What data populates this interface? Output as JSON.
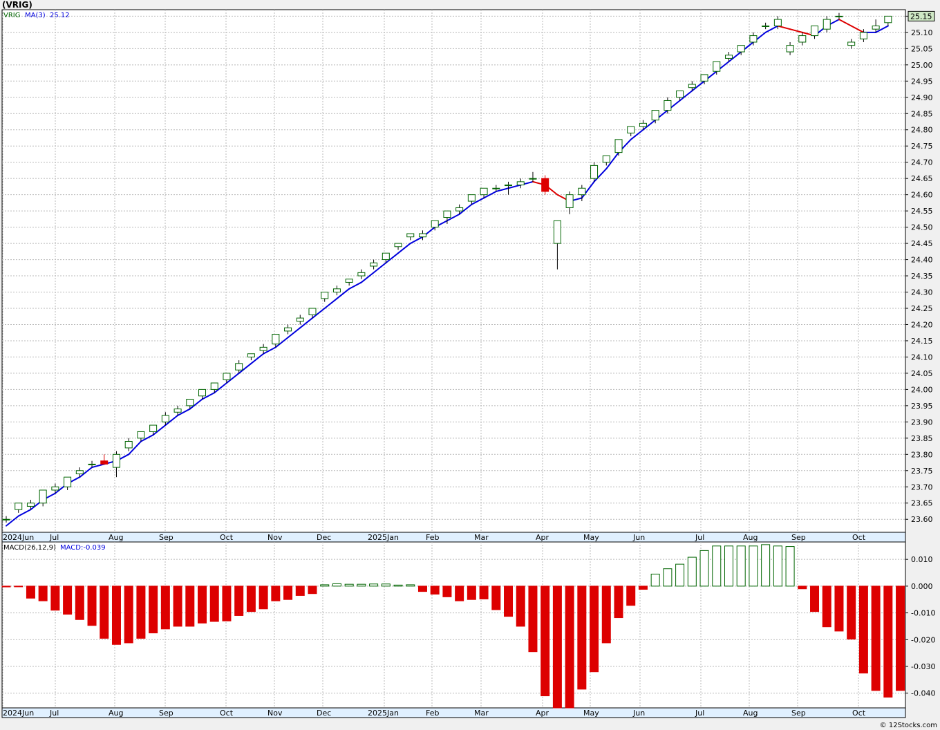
{
  "title": "(VRIG)",
  "credit": "© 12Stocks.com",
  "colors": {
    "up": "#006400",
    "down": "#dd0000",
    "ma_up": "#0000dd",
    "ma_down": "#dd0000",
    "grid": "#b8b8b8",
    "label_bg": "#cfe8c5"
  },
  "chart_data": [
    {
      "type": "candlestick",
      "legend": "VRIG",
      "ma_label": "MA(3)",
      "ma_value": "25.12",
      "last_price_label": "25.15",
      "ylim": [
        23.56,
        25.17
      ],
      "yticks": [
        23.6,
        23.65,
        23.7,
        23.75,
        23.8,
        23.85,
        23.9,
        23.95,
        24.0,
        24.05,
        24.1,
        24.15,
        24.2,
        24.25,
        24.3,
        24.35,
        24.4,
        24.45,
        24.5,
        24.55,
        24.6,
        24.65,
        24.7,
        24.75,
        24.8,
        24.85,
        24.9,
        24.95,
        25.0,
        25.05,
        25.1,
        25.15
      ],
      "xlabels": [
        "2024Jun",
        "Jul",
        "Aug",
        "Sep",
        "Oct",
        "Nov",
        "Dec",
        "2025Jan",
        "Feb",
        "Mar",
        "Apr",
        "May",
        "Jun",
        "Jul",
        "Aug",
        "Sep",
        "Oct"
      ],
      "candles": [
        [
          23.6,
          23.61,
          23.59,
          23.6
        ],
        [
          23.63,
          23.65,
          23.62,
          23.65
        ],
        [
          23.64,
          23.66,
          23.63,
          23.65
        ],
        [
          23.65,
          23.69,
          23.64,
          23.69
        ],
        [
          23.69,
          23.71,
          23.68,
          23.7
        ],
        [
          23.7,
          23.73,
          23.69,
          23.73
        ],
        [
          23.74,
          23.76,
          23.73,
          23.75
        ],
        [
          23.77,
          23.78,
          23.76,
          23.77
        ],
        [
          23.78,
          23.8,
          23.77,
          23.77
        ],
        [
          23.76,
          23.81,
          23.73,
          23.8
        ],
        [
          23.82,
          23.85,
          23.81,
          23.84
        ],
        [
          23.85,
          23.87,
          23.84,
          23.87
        ],
        [
          23.87,
          23.89,
          23.86,
          23.89
        ],
        [
          23.9,
          23.93,
          23.89,
          23.92
        ],
        [
          23.93,
          23.95,
          23.92,
          23.94
        ],
        [
          23.95,
          23.97,
          23.94,
          23.97
        ],
        [
          23.98,
          24.0,
          23.97,
          24.0
        ],
        [
          24.0,
          24.02,
          23.99,
          24.02
        ],
        [
          24.03,
          24.05,
          24.02,
          24.05
        ],
        [
          24.06,
          24.09,
          24.05,
          24.08
        ],
        [
          24.1,
          24.11,
          24.09,
          24.11
        ],
        [
          24.12,
          24.14,
          24.11,
          24.13
        ],
        [
          24.14,
          24.17,
          24.13,
          24.17
        ],
        [
          24.18,
          24.2,
          24.17,
          24.19
        ],
        [
          24.21,
          24.23,
          24.2,
          24.22
        ],
        [
          24.23,
          24.25,
          24.22,
          24.25
        ],
        [
          24.28,
          24.3,
          24.27,
          24.3
        ],
        [
          24.3,
          24.32,
          24.29,
          24.31
        ],
        [
          24.33,
          24.34,
          24.32,
          24.34
        ],
        [
          24.35,
          24.37,
          24.34,
          24.36
        ],
        [
          24.38,
          24.4,
          24.37,
          24.39
        ],
        [
          24.4,
          24.42,
          24.39,
          24.42
        ],
        [
          24.44,
          24.45,
          24.43,
          24.45
        ],
        [
          24.47,
          24.48,
          24.46,
          24.48
        ],
        [
          24.47,
          24.49,
          24.46,
          24.48
        ],
        [
          24.5,
          24.52,
          24.49,
          24.52
        ],
        [
          24.53,
          24.55,
          24.51,
          24.55
        ],
        [
          24.55,
          24.57,
          24.54,
          24.56
        ],
        [
          24.58,
          24.6,
          24.57,
          24.6
        ],
        [
          24.6,
          24.62,
          24.59,
          24.62
        ],
        [
          24.62,
          24.63,
          24.61,
          24.62
        ],
        [
          24.63,
          24.64,
          24.6,
          24.63
        ],
        [
          24.63,
          24.65,
          24.62,
          24.64
        ],
        [
          24.65,
          24.67,
          24.64,
          24.65
        ],
        [
          24.65,
          24.66,
          24.6,
          24.61
        ],
        [
          24.45,
          24.52,
          24.37,
          24.52
        ],
        [
          24.56,
          24.61,
          24.54,
          24.6
        ],
        [
          24.6,
          24.63,
          24.58,
          24.62
        ],
        [
          24.65,
          24.7,
          24.64,
          24.69
        ],
        [
          24.7,
          24.72,
          24.69,
          24.72
        ],
        [
          24.73,
          24.77,
          24.72,
          24.77
        ],
        [
          24.79,
          24.81,
          24.78,
          24.81
        ],
        [
          24.81,
          24.83,
          24.8,
          24.82
        ],
        [
          24.83,
          24.86,
          24.82,
          24.86
        ],
        [
          24.86,
          24.9,
          24.85,
          24.89
        ],
        [
          24.9,
          24.92,
          24.89,
          24.92
        ],
        [
          24.93,
          24.95,
          24.92,
          24.94
        ],
        [
          24.95,
          24.97,
          24.94,
          24.97
        ],
        [
          24.98,
          25.0,
          24.97,
          25.01
        ],
        [
          25.02,
          25.04,
          25.01,
          25.03
        ],
        [
          25.04,
          25.06,
          25.03,
          25.06
        ],
        [
          25.07,
          25.1,
          25.06,
          25.09
        ],
        [
          25.12,
          25.13,
          25.11,
          25.12
        ],
        [
          25.12,
          25.15,
          25.11,
          25.14
        ],
        [
          25.04,
          25.07,
          25.03,
          25.06
        ],
        [
          25.07,
          25.1,
          25.06,
          25.09
        ],
        [
          25.09,
          25.12,
          25.08,
          25.12
        ],
        [
          25.11,
          25.15,
          25.1,
          25.14
        ],
        [
          25.15,
          25.16,
          25.14,
          25.15
        ],
        [
          25.06,
          25.08,
          25.05,
          25.07
        ],
        [
          25.08,
          25.11,
          25.07,
          25.1
        ],
        [
          25.11,
          25.14,
          25.1,
          25.12
        ],
        [
          25.13,
          25.15,
          25.12,
          25.15
        ]
      ],
      "ma": [
        23.58,
        23.61,
        23.63,
        23.66,
        23.68,
        23.71,
        23.73,
        23.76,
        23.77,
        23.78,
        23.8,
        23.84,
        23.86,
        23.89,
        23.92,
        23.94,
        23.97,
        23.99,
        24.02,
        24.05,
        24.08,
        24.11,
        24.13,
        24.16,
        24.19,
        24.22,
        24.25,
        24.28,
        24.31,
        24.33,
        24.36,
        24.39,
        24.42,
        24.45,
        24.47,
        24.5,
        24.52,
        24.54,
        24.57,
        24.59,
        24.61,
        24.62,
        24.63,
        24.64,
        24.63,
        24.6,
        24.58,
        24.59,
        24.64,
        24.68,
        24.73,
        24.77,
        24.8,
        24.83,
        24.86,
        24.89,
        24.92,
        24.95,
        24.98,
        25.01,
        25.04,
        25.07,
        25.1,
        25.12,
        25.11,
        25.1,
        25.09,
        25.12,
        25.14,
        25.12,
        25.1,
        25.1,
        25.12
      ]
    },
    {
      "type": "bar",
      "label": "MACD(26,12,9)",
      "value_label": "MACD:-0.039",
      "ylim": [
        -0.0455,
        0.0165
      ],
      "yticks": [
        0.01,
        0.0,
        -0.01,
        -0.02,
        -0.03,
        -0.04
      ],
      "ytick_labels": [
        "0.010",
        "0.000",
        "-0.010",
        "-0.020",
        "-0.030",
        "-0.040"
      ],
      "values": [
        -0.0003,
        -0.0002,
        -0.0045,
        -0.0055,
        -0.009,
        -0.0105,
        -0.0125,
        -0.0147,
        -0.0195,
        -0.0218,
        -0.0212,
        -0.0195,
        -0.0175,
        -0.016,
        -0.015,
        -0.015,
        -0.0138,
        -0.0132,
        -0.013,
        -0.011,
        -0.0095,
        -0.0085,
        -0.0055,
        -0.005,
        -0.0035,
        -0.0028,
        0.0005,
        0.0009,
        0.0007,
        0.0007,
        0.0008,
        0.0008,
        0.0004,
        0.0005,
        -0.002,
        -0.003,
        -0.004,
        -0.0055,
        -0.005,
        -0.0048,
        -0.0088,
        -0.0113,
        -0.015,
        -0.0245,
        -0.041,
        -0.0455,
        -0.0455,
        -0.0385,
        -0.032,
        -0.0212,
        -0.0118,
        -0.0072,
        -0.0012,
        0.0045,
        0.0065,
        0.0082,
        0.0108,
        0.0133,
        0.015,
        0.015,
        0.015,
        0.015,
        0.0155,
        0.015,
        0.0148,
        -0.001,
        -0.0095,
        -0.0152,
        -0.0168,
        -0.0198,
        -0.0325,
        -0.039,
        -0.0415,
        -0.039
      ]
    }
  ]
}
